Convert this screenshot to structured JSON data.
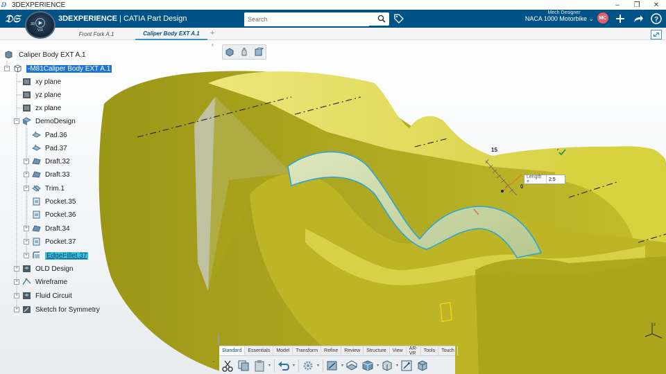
{
  "window": {
    "title": "3DEXPERIENCE",
    "controls": [
      "–",
      "❐",
      "✕"
    ]
  },
  "header": {
    "brand": "3DEXPERIENCE",
    "app_name": "CATIA Part Design",
    "search_placeholder": "Search",
    "user_role": "Mech Designer",
    "project": "NACA 1000 Motorbike ⌄",
    "avatar_initials": "MC",
    "compass_version": "V.R",
    "compass_label": "3D"
  },
  "tabs": [
    {
      "label": "Front Fork A.1",
      "active": false
    },
    {
      "label": "Caliper Body EXT A.1",
      "active": true
    }
  ],
  "tab_add": "+",
  "tree": {
    "nodes": [
      {
        "label": "Caliper Body EXT A.1",
        "icon": "product-icon",
        "level": 0
      },
      {
        "label": "-M81Caliper Body EXT A.1",
        "icon": "part-icon",
        "level": 1,
        "selected": true
      },
      {
        "label": "xy plane",
        "icon": "plane-icon",
        "level": 2
      },
      {
        "label": "yz plane",
        "icon": "plane-icon",
        "level": 2
      },
      {
        "label": "zx plane",
        "icon": "plane-icon",
        "level": 2
      },
      {
        "label": "DemoDesign",
        "icon": "body-icon",
        "level": 2
      },
      {
        "label": "Pad.36",
        "icon": "pad-icon",
        "level": 3
      },
      {
        "label": "Pad.37",
        "icon": "pad-icon",
        "level": 3
      },
      {
        "label": "Draft.32",
        "icon": "draft-icon",
        "level": 3
      },
      {
        "label": "Draft.33",
        "icon": "draft-icon",
        "level": 3
      },
      {
        "label": "Trim.1",
        "icon": "trim-icon",
        "level": 3
      },
      {
        "label": "Pocket.35",
        "icon": "pocket-icon",
        "level": 3
      },
      {
        "label": "Pocket.36",
        "icon": "pocket-icon",
        "level": 3
      },
      {
        "label": "Draft.34",
        "icon": "draft-icon",
        "level": 3
      },
      {
        "label": "Pocket.37",
        "icon": "pocket-icon",
        "level": 3
      },
      {
        "label": "EdgeFillet.37",
        "icon": "fillet-icon",
        "level": 3,
        "selected": true
      },
      {
        "label": "OLD Design",
        "icon": "body-icon",
        "level": 1
      },
      {
        "label": "Wireframe",
        "icon": "wireframe-icon",
        "level": 1
      },
      {
        "label": "Fluid Circuit",
        "icon": "body-icon",
        "level": 1
      },
      {
        "label": "Sketch for Symmetry",
        "icon": "sketch-icon",
        "level": 1
      }
    ]
  },
  "manipulator": {
    "length_label": "Length =",
    "length_value": "2.5",
    "ruler_top": "15",
    "ruler_zero": "0"
  },
  "action_bar": {
    "tabs": [
      "Standard",
      "Essentials",
      "Model",
      "Transform",
      "Refine",
      "Review",
      "Structure",
      "View",
      "AR-VR",
      "Tools",
      "Touch"
    ],
    "active_tab": "Standard"
  },
  "colors": {
    "header_blue": "#005386",
    "part_yellow": "#c8c12a",
    "selection_blue": "#1e73d6",
    "highlight_cyan": "#35c3d6",
    "fillet_edge": "#2aa6d6"
  }
}
